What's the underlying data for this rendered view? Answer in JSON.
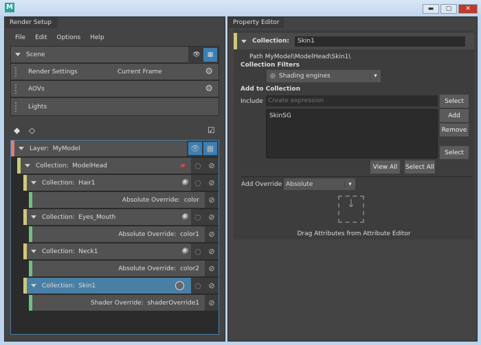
{
  "window": {
    "app_icon": "M",
    "minimize": "▬",
    "maximize": "▢",
    "close": "✕"
  },
  "left": {
    "tab": "Render Setup",
    "menu": [
      "File",
      "Edit",
      "Options",
      "Help"
    ],
    "scene": {
      "label": "Scene"
    },
    "rows": [
      {
        "label": "Render Settings",
        "value": "Current Frame"
      },
      {
        "label": "AOVs",
        "value": ""
      },
      {
        "label": "Lights",
        "value": ""
      }
    ],
    "tree": {
      "layer": {
        "prefix": "Layer:",
        "name": "MyModel"
      },
      "items": [
        {
          "type": "collection",
          "prefix": "Collection:",
          "name": "ModelHead"
        },
        {
          "type": "collection",
          "prefix": "Collection:",
          "name": "Hair1"
        },
        {
          "type": "override",
          "prefix": "Absolute Override:",
          "name": "color"
        },
        {
          "type": "collection",
          "prefix": "Collection:",
          "name": "Eyes_Mouth"
        },
        {
          "type": "override",
          "prefix": "Absolute Override:",
          "name": "color1"
        },
        {
          "type": "collection",
          "prefix": "Collection:",
          "name": "Neck1"
        },
        {
          "type": "override",
          "prefix": "Absolute Override:",
          "name": "color2"
        },
        {
          "type": "collection",
          "prefix": "Collection:",
          "name": "Skin1",
          "selected": true
        },
        {
          "type": "override",
          "prefix": "Shader Override:",
          "name": "shaderOverride1"
        }
      ]
    }
  },
  "right": {
    "tab": "Property Editor",
    "collection_label": "Collection:",
    "collection_name": "Skin1",
    "path_label": "Path",
    "path": "MyModel\\ModelHead\\Skin1\\",
    "filters_heading": "Collection Filters",
    "filter_value": "Shading engines",
    "add_heading": "Add to Collection",
    "include_label": "Include",
    "include_placeholder": "Create expression",
    "select1": "Select",
    "add": "Add",
    "remove": "Remove",
    "select2": "Select",
    "members": [
      "SkinSG"
    ],
    "view_all": "View All",
    "select_all": "Select All",
    "override_label": "Add Override",
    "override_value": "Absolute",
    "drag_text": "Drag Attributes from Attribute Editor"
  },
  "colors": {
    "layer": "#e07c7c",
    "collection": "#cfc87a",
    "override": "#6fbf82",
    "selected": "#4a7fa5",
    "active_icon": "#3c7fb4"
  }
}
